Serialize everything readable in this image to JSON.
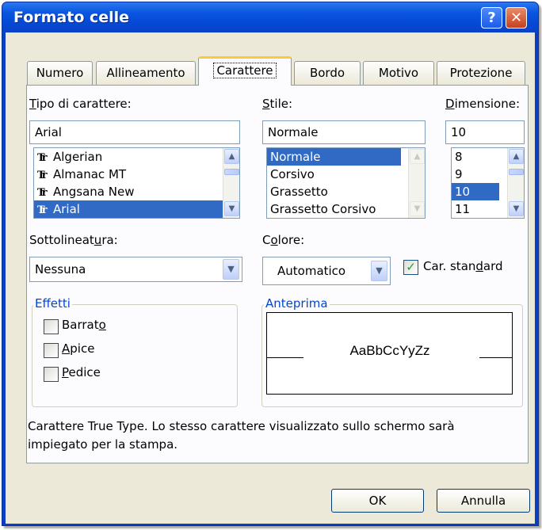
{
  "window": {
    "title": "Formato celle",
    "help_glyph": "?",
    "close_glyph": "✕"
  },
  "tabs": [
    {
      "label": "Numero"
    },
    {
      "label": "Allineamento"
    },
    {
      "label": "Carattere"
    },
    {
      "label": "Bordo"
    },
    {
      "label": "Motivo"
    },
    {
      "label": "Protezione"
    }
  ],
  "font": {
    "label_u": "T",
    "label_rest": "ipo di carattere:",
    "value": "Arial",
    "items": [
      "Algerian",
      "Almanac MT",
      "Angsana New",
      "Arial"
    ],
    "selected": "Arial",
    "icon_text": "Tr"
  },
  "style": {
    "label_u": "S",
    "label_rest": "tile:",
    "value": "Normale",
    "items": [
      "Normale",
      "Corsivo",
      "Grassetto",
      "Grassetto Corsivo"
    ],
    "selected": "Normale"
  },
  "size": {
    "label_u": "D",
    "label_rest": "imensione:",
    "value": "10",
    "items": [
      "8",
      "9",
      "10",
      "11"
    ],
    "selected": "10"
  },
  "underline": {
    "label_pre": "Sottolineat",
    "label_u": "u",
    "label_post": "ra:",
    "value": "Nessuna"
  },
  "color": {
    "label_pre": "C",
    "label_u": "o",
    "label_post": "lore:",
    "value": "Automatico"
  },
  "standard": {
    "label_pre": "Car. stan",
    "label_u": "d",
    "label_post": "ard",
    "checked": true
  },
  "effects": {
    "legend": "Effetti",
    "items": [
      {
        "pre": "Barrat",
        "u": "o",
        "post": "",
        "checked": false
      },
      {
        "pre": "",
        "u": "A",
        "post": "pice",
        "checked": false
      },
      {
        "pre": "",
        "u": "P",
        "post": "edice",
        "checked": false
      }
    ]
  },
  "preview": {
    "legend": "Anteprima",
    "sample": "AaBbCcYyZz"
  },
  "description": {
    "line1": "Carattere True Type. Lo stesso carattere visualizzato sullo schermo sarà",
    "line2": "impiegato per la stampa."
  },
  "buttons": {
    "ok": "OK",
    "cancel": "Annulla"
  },
  "glyphs": {
    "up": "▲",
    "down": "▼",
    "check": "✓"
  },
  "colors": {
    "titlebar": "#0a55e0",
    "selection": "#316ac5",
    "group_label": "#0046d5",
    "face": "#ece9d8"
  }
}
